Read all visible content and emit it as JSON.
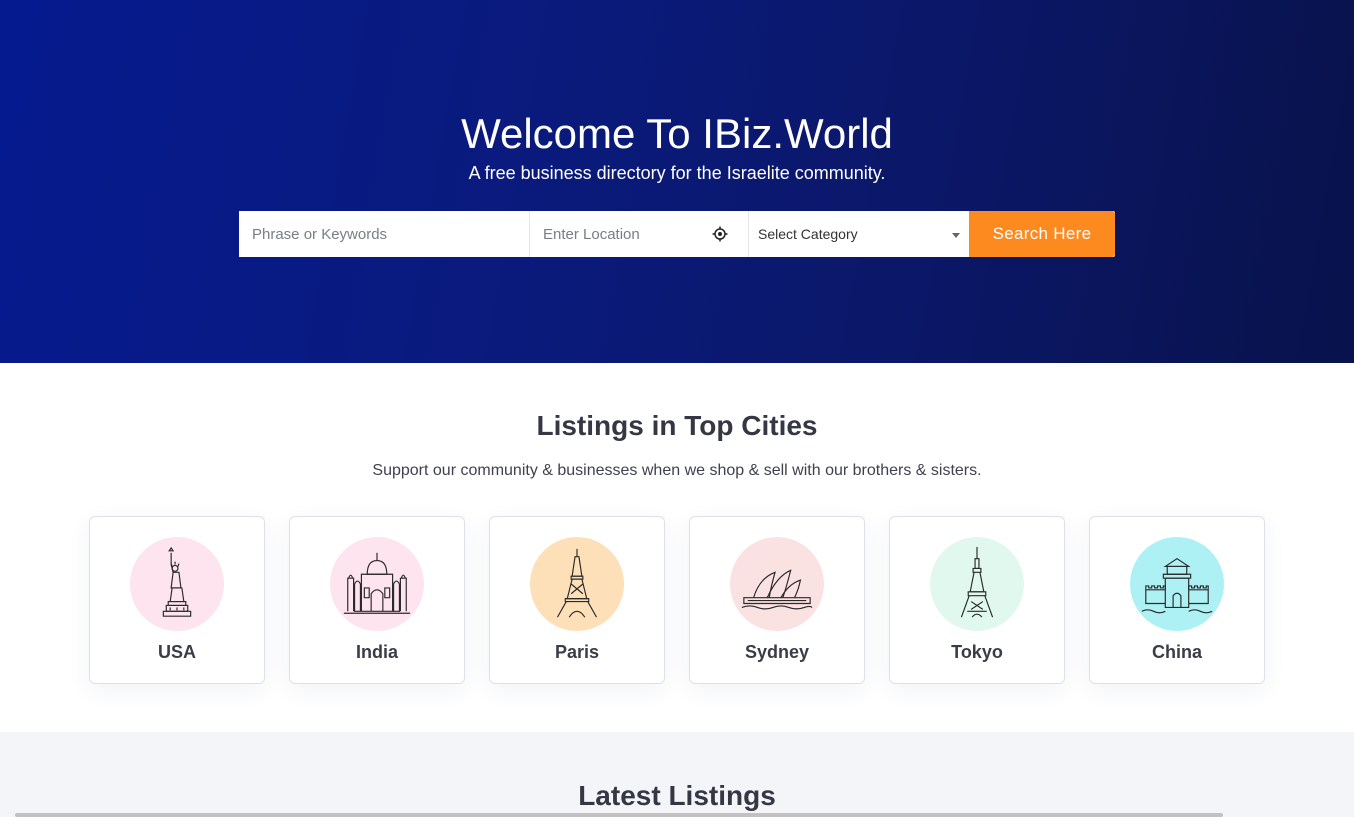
{
  "hero": {
    "title": "Welcome To IBiz.World",
    "subtitle": "A free business directory for the Israelite community.",
    "background_colors": [
      "#051a8f",
      "#08124b"
    ]
  },
  "search": {
    "keywords_placeholder": "Phrase or Keywords",
    "location_placeholder": "Enter Location",
    "category_selected": "Select Category",
    "button_label": "Search Here",
    "button_color": "#fc8a1f",
    "location_icon": "crosshair-icon",
    "category_icon": "caret-down-icon"
  },
  "cities_section": {
    "title": "Listings in Top Cities",
    "subtitle": "Support our community & businesses when we shop & sell with our brothers & sisters.",
    "cities": [
      {
        "name": "USA",
        "icon": "statue-of-liberty-icon",
        "circle_color": "#fde4ee"
      },
      {
        "name": "India",
        "icon": "taj-mahal-icon",
        "circle_color": "#fde4ee"
      },
      {
        "name": "Paris",
        "icon": "eiffel-tower-icon",
        "circle_color": "#fde0b8"
      },
      {
        "name": "Sydney",
        "icon": "sydney-opera-house-icon",
        "circle_color": "#fbe2e2"
      },
      {
        "name": "Tokyo",
        "icon": "tokyo-tower-icon",
        "circle_color": "#e1f8ee"
      },
      {
        "name": "China",
        "icon": "great-wall-icon",
        "circle_color": "#aef1f5"
      }
    ]
  },
  "latest_section": {
    "title": "Latest Listings"
  }
}
